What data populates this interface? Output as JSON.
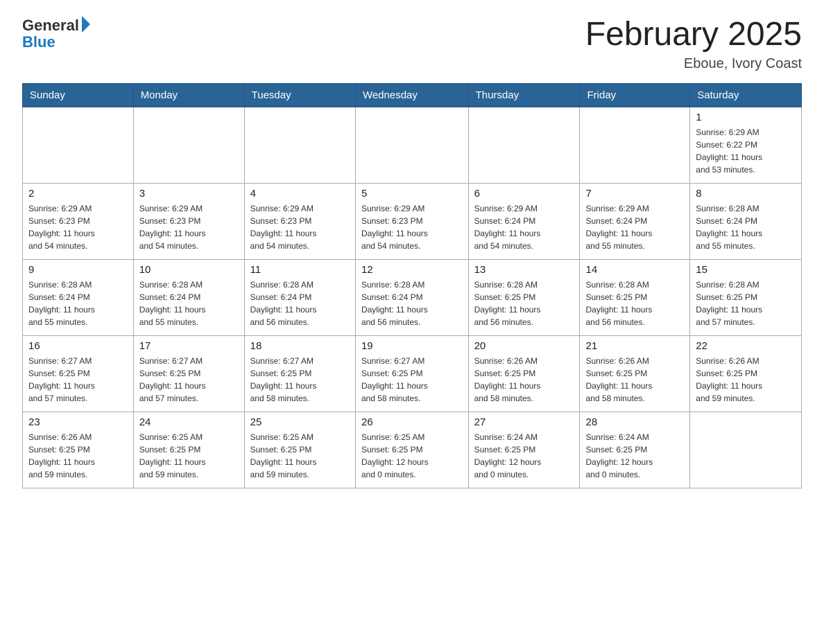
{
  "logo": {
    "general": "General",
    "blue": "Blue"
  },
  "title": "February 2025",
  "location": "Eboue, Ivory Coast",
  "days_header": [
    "Sunday",
    "Monday",
    "Tuesday",
    "Wednesday",
    "Thursday",
    "Friday",
    "Saturday"
  ],
  "weeks": [
    [
      {
        "day": "",
        "info": ""
      },
      {
        "day": "",
        "info": ""
      },
      {
        "day": "",
        "info": ""
      },
      {
        "day": "",
        "info": ""
      },
      {
        "day": "",
        "info": ""
      },
      {
        "day": "",
        "info": ""
      },
      {
        "day": "1",
        "info": "Sunrise: 6:29 AM\nSunset: 6:22 PM\nDaylight: 11 hours\nand 53 minutes."
      }
    ],
    [
      {
        "day": "2",
        "info": "Sunrise: 6:29 AM\nSunset: 6:23 PM\nDaylight: 11 hours\nand 54 minutes."
      },
      {
        "day": "3",
        "info": "Sunrise: 6:29 AM\nSunset: 6:23 PM\nDaylight: 11 hours\nand 54 minutes."
      },
      {
        "day": "4",
        "info": "Sunrise: 6:29 AM\nSunset: 6:23 PM\nDaylight: 11 hours\nand 54 minutes."
      },
      {
        "day": "5",
        "info": "Sunrise: 6:29 AM\nSunset: 6:23 PM\nDaylight: 11 hours\nand 54 minutes."
      },
      {
        "day": "6",
        "info": "Sunrise: 6:29 AM\nSunset: 6:24 PM\nDaylight: 11 hours\nand 54 minutes."
      },
      {
        "day": "7",
        "info": "Sunrise: 6:29 AM\nSunset: 6:24 PM\nDaylight: 11 hours\nand 55 minutes."
      },
      {
        "day": "8",
        "info": "Sunrise: 6:28 AM\nSunset: 6:24 PM\nDaylight: 11 hours\nand 55 minutes."
      }
    ],
    [
      {
        "day": "9",
        "info": "Sunrise: 6:28 AM\nSunset: 6:24 PM\nDaylight: 11 hours\nand 55 minutes."
      },
      {
        "day": "10",
        "info": "Sunrise: 6:28 AM\nSunset: 6:24 PM\nDaylight: 11 hours\nand 55 minutes."
      },
      {
        "day": "11",
        "info": "Sunrise: 6:28 AM\nSunset: 6:24 PM\nDaylight: 11 hours\nand 56 minutes."
      },
      {
        "day": "12",
        "info": "Sunrise: 6:28 AM\nSunset: 6:24 PM\nDaylight: 11 hours\nand 56 minutes."
      },
      {
        "day": "13",
        "info": "Sunrise: 6:28 AM\nSunset: 6:25 PM\nDaylight: 11 hours\nand 56 minutes."
      },
      {
        "day": "14",
        "info": "Sunrise: 6:28 AM\nSunset: 6:25 PM\nDaylight: 11 hours\nand 56 minutes."
      },
      {
        "day": "15",
        "info": "Sunrise: 6:28 AM\nSunset: 6:25 PM\nDaylight: 11 hours\nand 57 minutes."
      }
    ],
    [
      {
        "day": "16",
        "info": "Sunrise: 6:27 AM\nSunset: 6:25 PM\nDaylight: 11 hours\nand 57 minutes."
      },
      {
        "day": "17",
        "info": "Sunrise: 6:27 AM\nSunset: 6:25 PM\nDaylight: 11 hours\nand 57 minutes."
      },
      {
        "day": "18",
        "info": "Sunrise: 6:27 AM\nSunset: 6:25 PM\nDaylight: 11 hours\nand 58 minutes."
      },
      {
        "day": "19",
        "info": "Sunrise: 6:27 AM\nSunset: 6:25 PM\nDaylight: 11 hours\nand 58 minutes."
      },
      {
        "day": "20",
        "info": "Sunrise: 6:26 AM\nSunset: 6:25 PM\nDaylight: 11 hours\nand 58 minutes."
      },
      {
        "day": "21",
        "info": "Sunrise: 6:26 AM\nSunset: 6:25 PM\nDaylight: 11 hours\nand 58 minutes."
      },
      {
        "day": "22",
        "info": "Sunrise: 6:26 AM\nSunset: 6:25 PM\nDaylight: 11 hours\nand 59 minutes."
      }
    ],
    [
      {
        "day": "23",
        "info": "Sunrise: 6:26 AM\nSunset: 6:25 PM\nDaylight: 11 hours\nand 59 minutes."
      },
      {
        "day": "24",
        "info": "Sunrise: 6:25 AM\nSunset: 6:25 PM\nDaylight: 11 hours\nand 59 minutes."
      },
      {
        "day": "25",
        "info": "Sunrise: 6:25 AM\nSunset: 6:25 PM\nDaylight: 11 hours\nand 59 minutes."
      },
      {
        "day": "26",
        "info": "Sunrise: 6:25 AM\nSunset: 6:25 PM\nDaylight: 12 hours\nand 0 minutes."
      },
      {
        "day": "27",
        "info": "Sunrise: 6:24 AM\nSunset: 6:25 PM\nDaylight: 12 hours\nand 0 minutes."
      },
      {
        "day": "28",
        "info": "Sunrise: 6:24 AM\nSunset: 6:25 PM\nDaylight: 12 hours\nand 0 minutes."
      },
      {
        "day": "",
        "info": ""
      }
    ]
  ]
}
